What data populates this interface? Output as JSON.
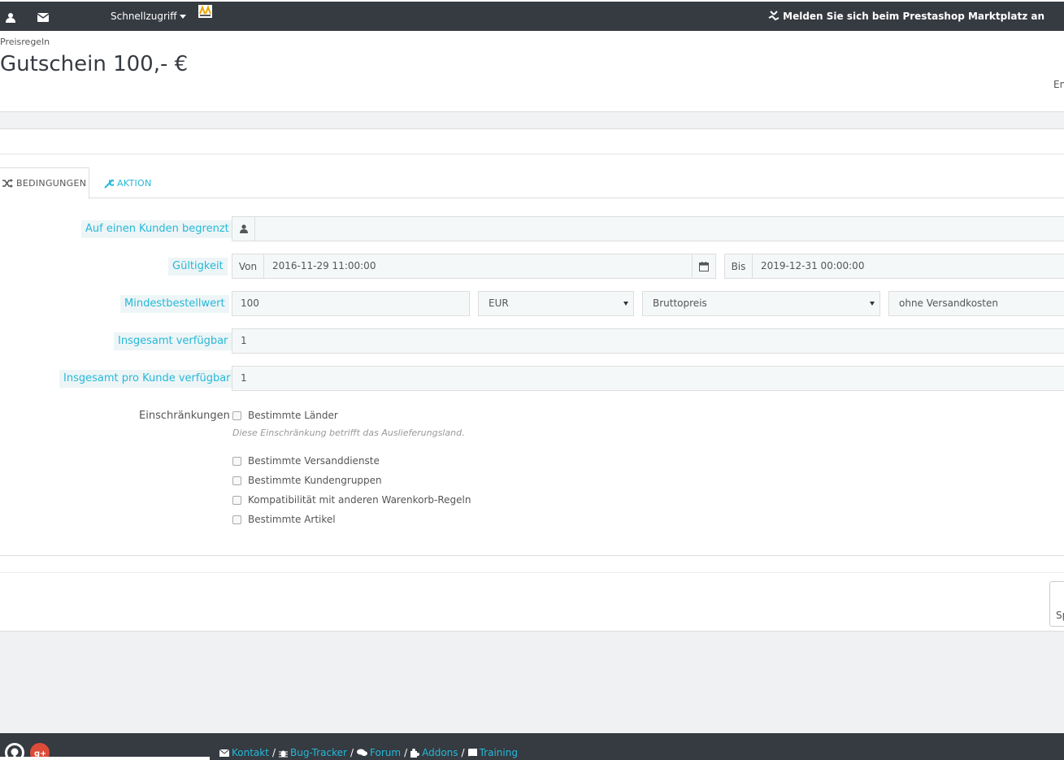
{
  "topbar": {
    "quick_access": "Schnellzugriff",
    "marketplace": "Melden Sie sich beim Prestashop Marktplatz an"
  },
  "header": {
    "breadcrumb": "Preisregeln",
    "title": "Gutschein 100,- €",
    "right_text": "En"
  },
  "tabs": {
    "conditions": "BEDINGUNGEN",
    "action": "AKTION"
  },
  "form": {
    "customer_label": "Auf einen Kunden begrenzt",
    "customer_value": "",
    "validity_label": "Gültigkeit",
    "from_label": "Von",
    "from_value": "2016-11-29 11:00:00",
    "to_label": "Bis",
    "to_value": "2019-12-31 00:00:00",
    "min_amount_label": "Mindestbestellwert",
    "min_amount_value": "100",
    "currency": "EUR",
    "tax": "Bruttopreis",
    "shipping": "ohne Versandkosten",
    "total_available_label": "Insgesamt verfügbar",
    "total_available_value": "1",
    "per_customer_label": "Insgesamt pro Kunde verfügbar",
    "per_customer_value": "1",
    "restrictions_label": "Einschränkungen",
    "restrictions": [
      "Bestimmte Länder",
      "Bestimmte Versanddienste",
      "Bestimmte Kundengruppen",
      "Kompatibilität mit anderen Warenkorb-Regeln",
      "Bestimmte Artikel"
    ],
    "country_hint": "Diese Einschränkung betrifft das Auslieferungsland."
  },
  "actions": {
    "save": "Sp"
  },
  "footer": {
    "links": [
      "Kontakt",
      "Bug-Tracker",
      "Forum",
      "Addons",
      "Training"
    ]
  },
  "colors": {
    "accent": "#25b9d7",
    "topbar": "#363a41"
  }
}
